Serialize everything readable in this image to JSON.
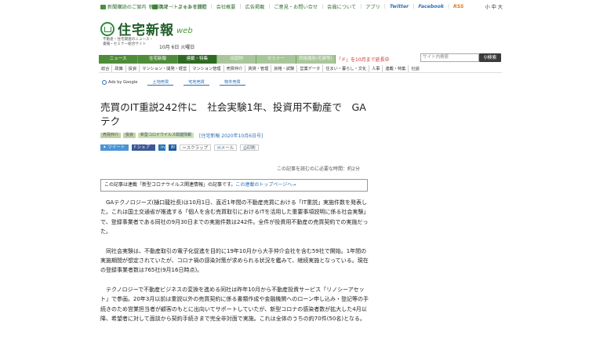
{
  "topbar": {
    "left": [
      "新聞購読のご案内",
      "スマートフォンで読む"
    ],
    "right": [
      "新聞購読",
      "よくある質問",
      "会社概要",
      "広告掲載",
      "ご意見・お問い合せ",
      "会員について",
      "アプリ"
    ],
    "social": [
      "Twitter",
      "Facebook",
      "RSS"
    ],
    "font_size": "小 中 大"
  },
  "logo": {
    "text": "住宅新報",
    "suffix": "web"
  },
  "tagline": {
    "line1": "不動産・住宅関連のニュース・",
    "line2": "書籍・セミナー総合サイト"
  },
  "date": "10月 6日 火曜日",
  "mainnav": [
    {
      "label": "ニュース"
    },
    {
      "label": "住宅新報"
    },
    {
      "label": "連載・特集"
    },
    {
      "label": "出版物"
    },
    {
      "label": "セミナー"
    },
    {
      "label": "資格講座(宅建等)"
    }
  ],
  "navnote": "「ド」を10月まで延長中",
  "search": {
    "placeholder": "サイト内検索",
    "button": "検索"
  },
  "subnav": [
    "総合",
    "政策",
    "投資",
    "マンション・開発・経営",
    "マンション管理",
    "売買仲介",
    "賃貸・管理",
    "資格・試験",
    "営業データ",
    "住まい・暮らし・文化",
    "人事",
    "連載・特集",
    "社説"
  ],
  "ads": {
    "label": "Ads by Google",
    "buttons": [
      "土地売買",
      "宅地売買",
      "物件売買"
    ]
  },
  "article": {
    "title": "売買のIT重説242件に　社会実験1年、投資用不動産で　GAテク",
    "tags": [
      "売買仲介",
      "投資",
      "新型コロナウイルス関連情報"
    ],
    "byline": "[住宅新報 2020年10月6日号]",
    "share": {
      "tweet": "ツイート",
      "facebook": "シェア",
      "linkedin": "in",
      "bookmark": "B!",
      "scrap": "スクラップ",
      "mail": "メール",
      "print": "印刷"
    },
    "readtime": "この記事を読むのに必要な時間：約2分",
    "note_text": "この記事は連載「新型コロナウイルス関連情報」の記事です。",
    "note_link": "この連載のトップページへ→",
    "paragraphs": [
      "GAテクノロジーズ(樋口龍社長)は10月1日、直近1年間の不動産売買における「IT重説」実施件数を発表した。これは国土交通省が推進する「個人を含む売買取引におけるITを活用した重要事項説明に係る社会実験」で、登録事業者である同社の9月30日までの実施件数は242件。全件が投資用不動産の売買契約での実施だった。",
      "同社会実験は、不動産取引の電子化促進を目的に19年10月から大手仲介会社を含む59社で開始。1年間の実施期間が想定されていたが、コロナ禍の感染対策が求められる状況を鑑みて、継続実施となっている。現在の登録事業者数は765社(9月16日時点)。",
      "テクノロジーで不動産ビジネスの変換を進める同社は昨年10月から不動産投資サービス「リノシーアセット」で参画。20年3月以前は重説以外の売買契約に係る書類作成や金融機関へのローン申し込み・登記等の手続きのため営業担当者が顧客のもとに出向いてサポートしていたが、新型コロナの感染者数が拡大した4月以降、希望者に対して面談から契約手続きまで完全非対面で実施。これは全体のうちの約70件(50名)となる。"
    ]
  }
}
